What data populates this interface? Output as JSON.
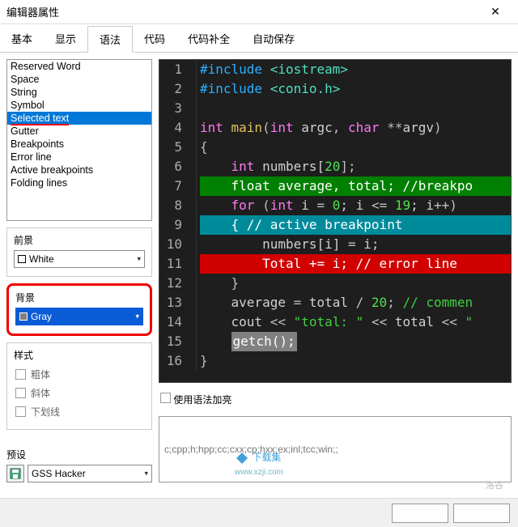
{
  "window": {
    "title": "编辑器属性"
  },
  "tabs": [
    "基本",
    "显示",
    "语法",
    "代码",
    "代码补全",
    "自动保存"
  ],
  "activeTab": "语法",
  "syntaxItems": [
    "Reserved Word",
    "Space",
    "String",
    "Symbol",
    "Selected text",
    "Gutter",
    "Breakpoints",
    "Error line",
    "Active breakpoints",
    "Folding lines"
  ],
  "selectedSyntaxItem": "Selected text",
  "foreground": {
    "label": "前景",
    "value": "White"
  },
  "background": {
    "label": "背景",
    "value": "Gray"
  },
  "styleGroup": {
    "label": "样式",
    "bold": "粗体",
    "italic": "斜体",
    "underline": "下划线"
  },
  "preset": {
    "label": "预设",
    "value": "GSS Hacker"
  },
  "syntaxHighlight": {
    "label": "使用语法加亮"
  },
  "extensions": {
    "placeholder": "c;cpp;h;hpp;cc;cxx;cp;hxx;ex;inl;tcc;win;;"
  },
  "code": {
    "lines": [
      {
        "n": 1,
        "frags": [
          {
            "t": "#include ",
            "c": "k-blue"
          },
          {
            "t": "<iostream>",
            "c": "k-cyan"
          }
        ]
      },
      {
        "n": 2,
        "frags": [
          {
            "t": "#include ",
            "c": "k-blue"
          },
          {
            "t": "<conio.h>",
            "c": "k-cyan"
          }
        ]
      },
      {
        "n": 3,
        "frags": []
      },
      {
        "n": 4,
        "frags": [
          {
            "t": "int ",
            "c": "k-mag"
          },
          {
            "t": "main",
            "c": "k-yel"
          },
          {
            "t": "(",
            "c": "k-op"
          },
          {
            "t": "int ",
            "c": "k-mag"
          },
          {
            "t": "argc",
            "c": ""
          },
          {
            "t": ", ",
            "c": "k-op"
          },
          {
            "t": "char ",
            "c": "k-mag"
          },
          {
            "t": "**",
            "c": "k-op"
          },
          {
            "t": "argv",
            "c": ""
          },
          {
            "t": ")",
            "c": "k-op"
          }
        ]
      },
      {
        "n": 5,
        "frags": [
          {
            "t": "{",
            "c": "k-op"
          }
        ]
      },
      {
        "n": 6,
        "frags": [
          {
            "t": "    ",
            "c": ""
          },
          {
            "t": "int ",
            "c": "k-mag"
          },
          {
            "t": "numbers[",
            "c": ""
          },
          {
            "t": "20",
            "c": "k-num"
          },
          {
            "t": "];",
            "c": "k-op"
          }
        ]
      },
      {
        "n": 7,
        "bg": "bg-green",
        "frags": [
          {
            "t": "    float average, total; //breakpo",
            "c": ""
          }
        ]
      },
      {
        "n": 8,
        "frags": [
          {
            "t": "    ",
            "c": ""
          },
          {
            "t": "for ",
            "c": "k-mag"
          },
          {
            "t": "(",
            "c": "k-op"
          },
          {
            "t": "int ",
            "c": "k-mag"
          },
          {
            "t": "i ",
            "c": ""
          },
          {
            "t": "= ",
            "c": "k-op"
          },
          {
            "t": "0",
            "c": "k-num"
          },
          {
            "t": "; i ",
            "c": ""
          },
          {
            "t": "<= ",
            "c": "k-op"
          },
          {
            "t": "19",
            "c": "k-num"
          },
          {
            "t": "; i",
            "c": ""
          },
          {
            "t": "++",
            "c": "k-op"
          },
          {
            "t": ")",
            "c": "k-op"
          }
        ]
      },
      {
        "n": 9,
        "bg": "bg-cyan",
        "frags": [
          {
            "t": "    { // active breakpoint",
            "c": ""
          }
        ]
      },
      {
        "n": 10,
        "frags": [
          {
            "t": "        numbers[i] ",
            "c": ""
          },
          {
            "t": "= ",
            "c": "k-op"
          },
          {
            "t": "i;",
            "c": ""
          }
        ]
      },
      {
        "n": 11,
        "bg": "bg-red",
        "frags": [
          {
            "t": "        Total += i; // error line",
            "c": ""
          }
        ]
      },
      {
        "n": 12,
        "frags": [
          {
            "t": "    }",
            "c": "k-op"
          }
        ]
      },
      {
        "n": 13,
        "frags": [
          {
            "t": "    average ",
            "c": ""
          },
          {
            "t": "= ",
            "c": "k-op"
          },
          {
            "t": "total ",
            "c": ""
          },
          {
            "t": "/ ",
            "c": "k-op"
          },
          {
            "t": "20",
            "c": "k-num"
          },
          {
            "t": "; ",
            "c": "k-op"
          },
          {
            "t": "// commen",
            "c": "k-grn"
          }
        ]
      },
      {
        "n": 14,
        "frags": [
          {
            "t": "    cout ",
            "c": ""
          },
          {
            "t": "<< ",
            "c": "k-op"
          },
          {
            "t": "\"total: \"",
            "c": "k-str"
          },
          {
            "t": " << ",
            "c": "k-op"
          },
          {
            "t": "total ",
            "c": ""
          },
          {
            "t": "<< ",
            "c": "k-op"
          },
          {
            "t": "\"",
            "c": "k-str"
          }
        ]
      },
      {
        "n": 15,
        "frags": [
          {
            "t": "    ",
            "c": ""
          },
          {
            "t": "getch();",
            "c": "",
            "bg": "bg-gray"
          }
        ]
      },
      {
        "n": 16,
        "frags": [
          {
            "t": "}",
            "c": "k-op"
          }
        ]
      }
    ]
  },
  "watermark": {
    "site": "下载集",
    "url": "www.xzji.com",
    "corner": "洛谷"
  }
}
